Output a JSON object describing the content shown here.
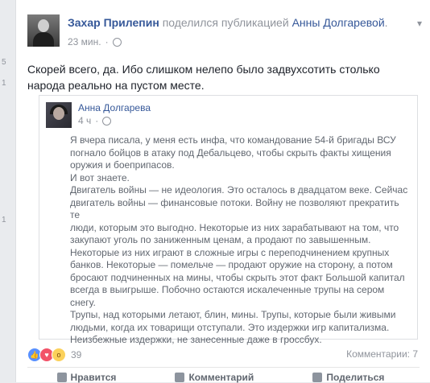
{
  "post": {
    "author": "Захар Прилепин",
    "action_text": "поделился публикацией",
    "shared_author": "Анны Долгаревой",
    "time": "23 мин.",
    "text_lines": [
      "Скорей всего, да. Ибо слишком нелепо было задвухсотить столько",
      "народа реально на пустом месте."
    ]
  },
  "shared_post": {
    "author": "Анна Долгарева",
    "time": "4 ч",
    "body_lines": [
      "Я вчера писала, у меня есть инфа, что командование 54-й бригады ВСУ",
      "погнало бойцов в атаку под Дебальцево, чтобы скрыть факты хищения",
      "оружия и боеприпасов.",
      "И вот знаете.",
      "Двигатель войны — не идеология. Это осталось в двадцатом веке. Сейчас",
      "двигатель войны — финансовые потоки. Войну не позволяют прекратить те",
      "люди, которым это выгодно. Некоторые из них зарабатывают на том, что",
      "закупают уголь по заниженным ценам, а продают по завышенным.",
      "Некоторые из них играют в сложные игры с переподчинением крупных",
      "банков. Некоторые — помельче — продают оружие на сторону, а потом",
      "бросают подчиненных на мины, чтобы скрыть этот факт Большой капитал",
      "всегда в выигрыше. Побочно остаются искалеченные трупы на сером снегу.",
      "Трупы, над которыми летают, блин, мины. Трупы, которые были живыми",
      "людьми, когда их товарищи отступали. Это издержки игр капитализма.",
      "Неизбежные издержки, не занесенные даже в гроссбух."
    ]
  },
  "footer": {
    "reactions_count": "39",
    "comments_label": "Комментарии: 7",
    "like_label": "Нравится",
    "comment_label": "Комментарий",
    "share_label": "Поделиться"
  },
  "left_strip": [
    "5",
    "1",
    "1"
  ],
  "colors": {
    "link": "#365899",
    "meta": "#90949c",
    "text": "#1d2129",
    "like": "#5890ff",
    "love": "#f25268",
    "wow": "#fbd15b"
  },
  "icons": [
    "globe-icon",
    "chevron-down-icon",
    "like-reaction-icon",
    "love-reaction-icon",
    "wow-reaction-icon",
    "like-icon",
    "comment-icon",
    "share-icon"
  ]
}
